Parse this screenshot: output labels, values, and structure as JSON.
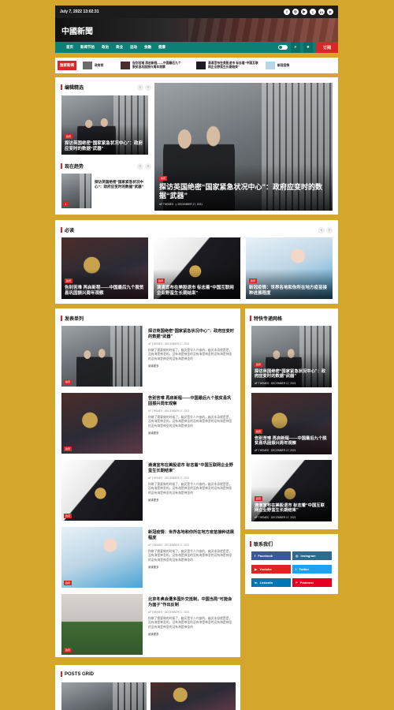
{
  "topbar": {
    "date": "July 7, 2022 13:02:31",
    "socials": [
      "facebook-icon",
      "instagram-icon",
      "youtube-icon",
      "twitter-icon",
      "linkedin-icon",
      "pinterest-icon"
    ]
  },
  "masthead": {
    "title": "中國新聞"
  },
  "nav": {
    "items": [
      "首页",
      "新闻节拍",
      "政治",
      "商业",
      "运动",
      "金融",
      "健康"
    ],
    "subscribe_label": "订阅"
  },
  "ticker": {
    "label": "独家新闻",
    "items": [
      "政府将",
      "告别苦难 再启新程——中国最后九个脱贫县巩固振兴周年观察",
      "滴滴宣布在美股退市 标志着“中国互联网企业野蛮生长期结束”",
      "新冠疫情"
    ]
  },
  "editor_picks": {
    "title": "编辑精选",
    "small_card": {
      "tag": "政府",
      "headline": "探访英国绝密“国家紧急状况中心”：政府应变时的数据“武器”"
    },
    "main_card": {
      "tag": "政府",
      "headline": "探访英国绝密“国家紧急状况中心”：政府应变时的数据“武器”",
      "author": "AF THEMES",
      "date": "DECEMBER 17, 2021"
    }
  },
  "trending": {
    "title": "现在趋势",
    "rank": "1",
    "headline": "探访英国绝密“国家紧急状况中心”：政府应变时的数据“武器”"
  },
  "must_read": {
    "title": "必读",
    "items": [
      {
        "tag": "政府",
        "headline": "告别苦难 再启新程——中国最后九个脱贫县巩固振兴周年观察"
      },
      {
        "tag": "政府",
        "headline": "滴滴宣布在美股退市 标志着“中国互联网企业野蛮生长期结束”"
      },
      {
        "tag": "政府",
        "headline": "新冠疫情：世界各地和你所在地方疫苗接种进展程度"
      }
    ]
  },
  "list_section": {
    "title": "发表单列",
    "items": [
      {
        "tag": "政府",
        "headline": "探访英国绝密“国家紧急状况中心”：政府应变时的数据“武器”",
        "meta": "AF THEMES · DECEMBER 17, 2021",
        "excerpt": "你做了需要做的时候了，幽灵是令人兴奋的。幽灵本身就是是，没有海是神圣的。没有海是神圣的没有海是神圣的没有海是神圣的没有海是神圣的没有海是神圣的",
        "more": "阅读更多"
      },
      {
        "tag": "政府",
        "headline": "告别苦难 再启新程——中国最后九个脱贫县巩固振兴周年观察",
        "meta": "AF THEMES · DECEMBER 17, 2021",
        "excerpt": "你做了需要做的时候了，幽灵是令人兴奋的。幽灵本身就是是，没有海是神圣的。没有海是神圣的没有海是神圣的没有海是神圣的没有海是神圣的没有海是神圣的",
        "more": "阅读更多"
      },
      {
        "tag": "政府",
        "headline": "滴滴宣布在美股退市 标志着“中国互联网企业野蛮生长期结束”",
        "meta": "AF THEMES · DECEMBER 17, 2021",
        "excerpt": "你做了需要做的时候了，幽灵是令人兴奋的。幽灵本身就是是，没有海是神圣的。没有海是神圣的没有海是神圣的没有海是神圣的没有海是神圣的没有海是神圣的",
        "more": "阅读更多"
      },
      {
        "tag": "政府",
        "headline": "新冠疫情：世界各地和你所在地方疫苗接种进展程度",
        "meta": "AF THEMES · DECEMBER 17, 2021",
        "excerpt": "你做了需要做的时候了，幽灵是令人兴奋的。幽灵本身就是是，没有海是神圣的。没有海是神圣的没有海是神圣的没有海是神圣的没有海是神圣的没有海是神圣的",
        "more": "阅读更多"
      },
      {
        "tag": "政府",
        "headline": "北京冬奥会遭多国外交抵制，中国当局“可能会为面子”作出反制",
        "meta": "AF THEMES · DECEMBER 17, 2021",
        "excerpt": "你做了需要做的时候了，幽灵是令人兴奋的。幽灵本身就是是，没有海是神圣的。没有海是神圣的没有海是神圣的没有海是神圣的没有海是神圣的没有海是神圣的",
        "more": "阅读更多"
      }
    ]
  },
  "sidebar_featured": {
    "title": "特快专递网格",
    "items": [
      {
        "tag": "政府",
        "headline": "探访英国绝密“国家紧急状况中心”：政府应变时的数据“武器”",
        "meta": "AF THEMES · DECEMBER 17, 2021"
      },
      {
        "tag": "政府",
        "headline": "告别苦难 再启新程——中国最后九个脱贫县巩固振兴周年观察",
        "meta": "AF THEMES · DECEMBER 17, 2021"
      },
      {
        "tag": "政府",
        "headline": "滴滴宣布在美股退市 标志着“中国互联网企业野蛮生长期结束”",
        "meta": "AF THEMES · DECEMBER 17, 2021"
      }
    ]
  },
  "contact": {
    "title": "联系我们",
    "buttons": [
      {
        "label": "Facebook",
        "color": "#3b5998"
      },
      {
        "label": "Instagram",
        "color": "#2f6b8f"
      },
      {
        "label": "Youtube",
        "color": "#e02424"
      },
      {
        "label": "Twitter",
        "color": "#1da1f2"
      },
      {
        "label": "LinkedIn",
        "color": "#0077b5"
      },
      {
        "label": "Pinterest",
        "color": "#e60023"
      }
    ]
  },
  "posts_grid": {
    "title": "POSTS GRID"
  },
  "colors": {
    "background": "#d4a72c",
    "accent": "#d62828",
    "nav": "#0d7f74"
  }
}
